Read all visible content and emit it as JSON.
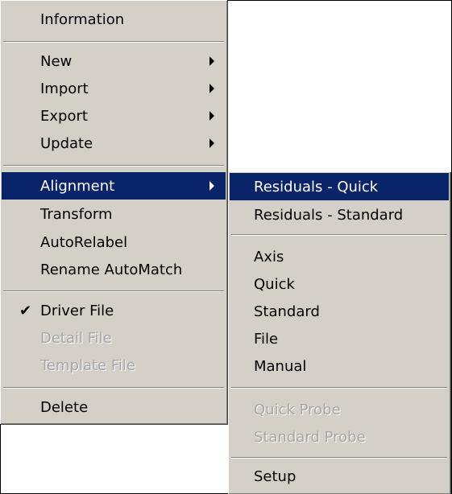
{
  "main_menu": {
    "information": "Information",
    "new": "New",
    "import": "Import",
    "export": "Export",
    "update": "Update",
    "alignment": "Alignment",
    "transform": "Transform",
    "autorelabel": "AutoRelabel",
    "rename_automatch": "Rename AutoMatch",
    "driver_file": "Driver File",
    "driver_file_checked": true,
    "detail_file": "Detail File",
    "template_file": "Template File",
    "delete": "Delete"
  },
  "alignment_submenu": {
    "residuals_quick": "Residuals - Quick",
    "residuals_standard": "Residuals - Standard",
    "axis": "Axis",
    "quick": "Quick",
    "standard": "Standard",
    "file": "File",
    "manual": "Manual",
    "quick_probe": "Quick Probe",
    "standard_probe": "Standard Probe",
    "setup": "Setup"
  },
  "colors": {
    "menu_bg": "#d4d0c8",
    "highlight_bg": "#0a246a",
    "disabled_text": "#a6a6a6"
  }
}
